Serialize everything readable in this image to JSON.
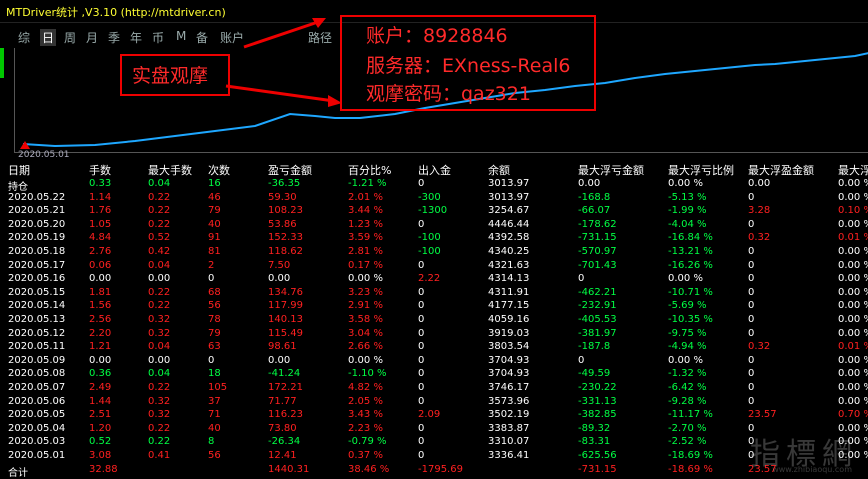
{
  "app": {
    "title": "MTDriver统计 ,V3.10 (http://mtdriver.cn)"
  },
  "tabs": [
    {
      "label": "综",
      "active": false
    },
    {
      "label": "日",
      "active": true
    },
    {
      "label": "周",
      "active": false
    },
    {
      "label": "月",
      "active": false
    },
    {
      "label": "季",
      "active": false
    },
    {
      "label": "年",
      "active": false
    },
    {
      "label": "币",
      "active": false
    },
    {
      "label": "M",
      "active": false
    },
    {
      "label": "备",
      "active": false
    },
    {
      "label": "账户",
      "active": false
    },
    {
      "label": "路径",
      "active": false
    }
  ],
  "chart": {
    "start_date": "2020.05.01",
    "line_color": "#1ea7ff"
  },
  "annotations": {
    "left_label": "实盘观摩",
    "account": "账户：8928846",
    "server": "服务器：EXness-Real6",
    "password": "观摩密码：qaz321",
    "accent_color": "#e00000"
  },
  "table": {
    "headers": [
      "日期",
      "手数",
      "最大手数",
      "次数",
      "盈亏金额",
      "百分比%",
      "出入金",
      "余额",
      "最大浮亏金额",
      "最大浮亏比例",
      "最大浮盈金额",
      "最大浮"
    ],
    "rows": [
      [
        "持仓",
        "0.33",
        "0.04",
        "16",
        "-36.35",
        "-1.21 %",
        "0",
        "3013.97",
        "0.00",
        "0.00 %",
        "0.00",
        "0.00 %"
      ],
      [
        "2020.05.22",
        "1.14",
        "0.22",
        "46",
        "59.30",
        "2.01 %",
        "-300",
        "3013.97",
        "-168.8",
        "-5.13 %",
        "0",
        "0.00 %"
      ],
      [
        "2020.05.21",
        "1.76",
        "0.22",
        "79",
        "108.23",
        "3.44 %",
        "-1300",
        "3254.67",
        "-66.07",
        "-1.99 %",
        "3.28",
        "0.10 %"
      ],
      [
        "2020.05.20",
        "1.05",
        "0.22",
        "40",
        "53.86",
        "1.23 %",
        "0",
        "4446.44",
        "-178.62",
        "-4.04 %",
        "0",
        "0.00 %"
      ],
      [
        "2020.05.19",
        "4.84",
        "0.52",
        "91",
        "152.33",
        "3.59 %",
        "-100",
        "4392.58",
        "-731.15",
        "-16.84 %",
        "0.32",
        "0.01 %"
      ],
      [
        "2020.05.18",
        "2.76",
        "0.42",
        "81",
        "118.62",
        "2.81 %",
        "-100",
        "4340.25",
        "-570.97",
        "-13.21 %",
        "0",
        "0.00 %"
      ],
      [
        "2020.05.17",
        "0.06",
        "0.04",
        "2",
        "7.50",
        "0.17 %",
        "0",
        "4321.63",
        "-701.43",
        "-16.26 %",
        "0",
        "0.00 %"
      ],
      [
        "2020.05.16",
        "0.00",
        "0.00",
        "0",
        "0.00",
        "0.00 %",
        "2.22",
        "4314.13",
        "0",
        "0.00 %",
        "0",
        "0.00 %"
      ],
      [
        "2020.05.15",
        "1.81",
        "0.22",
        "68",
        "134.76",
        "3.23 %",
        "0",
        "4311.91",
        "-462.21",
        "-10.71 %",
        "0",
        "0.00 %"
      ],
      [
        "2020.05.14",
        "1.56",
        "0.22",
        "56",
        "117.99",
        "2.91 %",
        "0",
        "4177.15",
        "-232.91",
        "-5.69 %",
        "0",
        "0.00 %"
      ],
      [
        "2020.05.13",
        "2.56",
        "0.32",
        "78",
        "140.13",
        "3.58 %",
        "0",
        "4059.16",
        "-405.53",
        "-10.35 %",
        "0",
        "0.00 %"
      ],
      [
        "2020.05.12",
        "2.20",
        "0.32",
        "79",
        "115.49",
        "3.04 %",
        "0",
        "3919.03",
        "-381.97",
        "-9.75 %",
        "0",
        "0.00 %"
      ],
      [
        "2020.05.11",
        "1.21",
        "0.04",
        "63",
        "98.61",
        "2.66 %",
        "0",
        "3803.54",
        "-187.8",
        "-4.94 %",
        "0.32",
        "0.01 %"
      ],
      [
        "2020.05.09",
        "0.00",
        "0.00",
        "0",
        "0.00",
        "0.00 %",
        "0",
        "3704.93",
        "0",
        "0.00 %",
        "0",
        "0.00 %"
      ],
      [
        "2020.05.08",
        "0.36",
        "0.04",
        "18",
        "-41.24",
        "-1.10 %",
        "0",
        "3704.93",
        "-49.59",
        "-1.32 %",
        "0",
        "0.00 %"
      ],
      [
        "2020.05.07",
        "2.49",
        "0.22",
        "105",
        "172.21",
        "4.82 %",
        "0",
        "3746.17",
        "-230.22",
        "-6.42 %",
        "0",
        "0.00 %"
      ],
      [
        "2020.05.06",
        "1.44",
        "0.32",
        "37",
        "71.77",
        "2.05 %",
        "0",
        "3573.96",
        "-331.13",
        "-9.28 %",
        "0",
        "0.00 %"
      ],
      [
        "2020.05.05",
        "2.51",
        "0.32",
        "71",
        "116.23",
        "3.43 %",
        "2.09",
        "3502.19",
        "-382.85",
        "-11.17 %",
        "23.57",
        "0.70 %"
      ],
      [
        "2020.05.04",
        "1.20",
        "0.22",
        "40",
        "73.80",
        "2.23 %",
        "0",
        "3383.87",
        "-89.32",
        "-2.70 %",
        "0",
        "0.00 %"
      ],
      [
        "2020.05.03",
        "0.52",
        "0.22",
        "8",
        "-26.34",
        "-0.79 %",
        "0",
        "3310.07",
        "-83.31",
        "-2.52 %",
        "0",
        "0.00 %"
      ],
      [
        "2020.05.01",
        "3.08",
        "0.41",
        "56",
        "12.41",
        "0.37 %",
        "0",
        "3336.41",
        "-625.56",
        "-18.69 %",
        "0",
        "0.00 %"
      ]
    ],
    "summary_label": "合计",
    "summary_values": [
      "32.88",
      "",
      "",
      "1440.31",
      "38.46 %",
      "-1795.69",
      "",
      "-731.15",
      "-18.69 %",
      "23.57",
      ""
    ]
  },
  "watermark": {
    "big": "指標網",
    "small": "www.zhibiaoqu.com"
  }
}
